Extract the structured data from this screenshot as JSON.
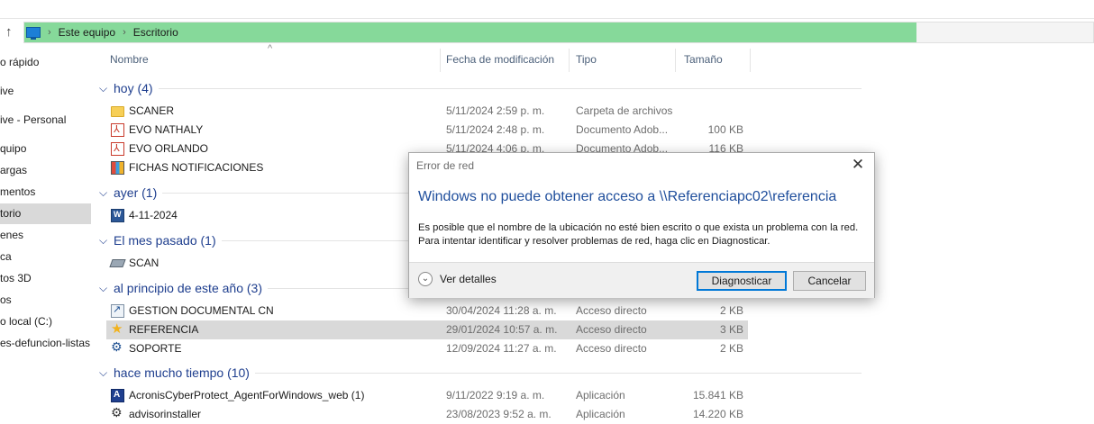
{
  "breadcrumb": {
    "items": [
      "Este equipo",
      "Escritorio"
    ]
  },
  "progress_fraction": 0.835,
  "nav": {
    "items": [
      {
        "label": "o rápido"
      },
      {
        "label": "ive"
      },
      {
        "label": "ive - Personal"
      },
      {
        "label": "quipo"
      },
      {
        "label": "argas"
      },
      {
        "label": "mentos"
      },
      {
        "label": "torio",
        "selected": true
      },
      {
        "label": "enes"
      },
      {
        "label": "ca"
      },
      {
        "label": "tos 3D"
      },
      {
        "label": "os"
      },
      {
        "label": "o local (C:)"
      },
      {
        "label": "es-defuncion-listas"
      }
    ]
  },
  "columns": {
    "name": "Nombre",
    "date": "Fecha de modificación",
    "type": "Tipo",
    "size": "Tamaño"
  },
  "groups": [
    {
      "label": "hoy (4)",
      "rows": [
        {
          "name": "SCANER",
          "date": "5/11/2024 2:59 p. m.",
          "type": "Carpeta de archivos",
          "size": "",
          "icon": "folder-icon"
        },
        {
          "name": "EVO NATHALY",
          "date": "5/11/2024 2:48 p. m.",
          "type": "Documento Adob...",
          "size": "100 KB",
          "icon": "pdf-icon"
        },
        {
          "name": "EVO ORLANDO",
          "date": "5/11/2024 4:06 p. m.",
          "type": "Documento Adob...",
          "size": "116 KB",
          "icon": "pdf-icon"
        },
        {
          "name": "FICHAS NOTIFICACIONES",
          "date": "",
          "type": "",
          "size": "",
          "icon": "app-icon"
        }
      ]
    },
    {
      "label": "ayer (1)",
      "rows": [
        {
          "name": "4-11-2024",
          "date": "",
          "type": "",
          "size": "",
          "icon": "word-icon"
        }
      ]
    },
    {
      "label": "El mes pasado (1)",
      "rows": [
        {
          "name": "SCAN",
          "date": "",
          "type": "",
          "size": "",
          "icon": "scanner-icon"
        }
      ]
    },
    {
      "label": "al principio de este año (3)",
      "rows": [
        {
          "name": "GESTION DOCUMENTAL CN",
          "date": "30/04/2024 11:28 a. m.",
          "type": "Acceso directo",
          "size": "2 KB",
          "icon": "shortcut-icon"
        },
        {
          "name": "REFERENCIA",
          "date": "29/01/2024 10:57 a. m.",
          "type": "Acceso directo",
          "size": "3 KB",
          "icon": "star-shortcut-icon",
          "selected": true
        },
        {
          "name": "SOPORTE",
          "date": "12/09/2024 11:27 a. m.",
          "type": "Acceso directo",
          "size": "2 KB",
          "icon": "gear-shortcut-icon"
        }
      ]
    },
    {
      "label": "hace mucho tiempo (10)",
      "rows": [
        {
          "name": "AcronisCyberProtect_AgentForWindows_web (1)",
          "date": "9/11/2022 9:19 a. m.",
          "type": "Aplicación",
          "size": "15.841 KB",
          "icon": "acronis-icon"
        },
        {
          "name": "advisorinstaller",
          "date": "23/08/2023 9:52 a. m.",
          "type": "Aplicación",
          "size": "14.220 KB",
          "icon": "installer-icon"
        }
      ]
    }
  ],
  "dialog": {
    "title": "Error de red",
    "heading": "Windows no puede obtener acceso a \\\\Referenciapc02\\referencia",
    "body": "Es posible que el nombre de la ubicación no esté bien escrito o que exista un problema con la red. Para intentar identificar y resolver problemas de red, haga clic en Diagnosticar.",
    "details_label": "Ver detalles",
    "diagnose_label": "Diagnosticar",
    "cancel_label": "Cancelar",
    "close_glyph": "✕"
  }
}
